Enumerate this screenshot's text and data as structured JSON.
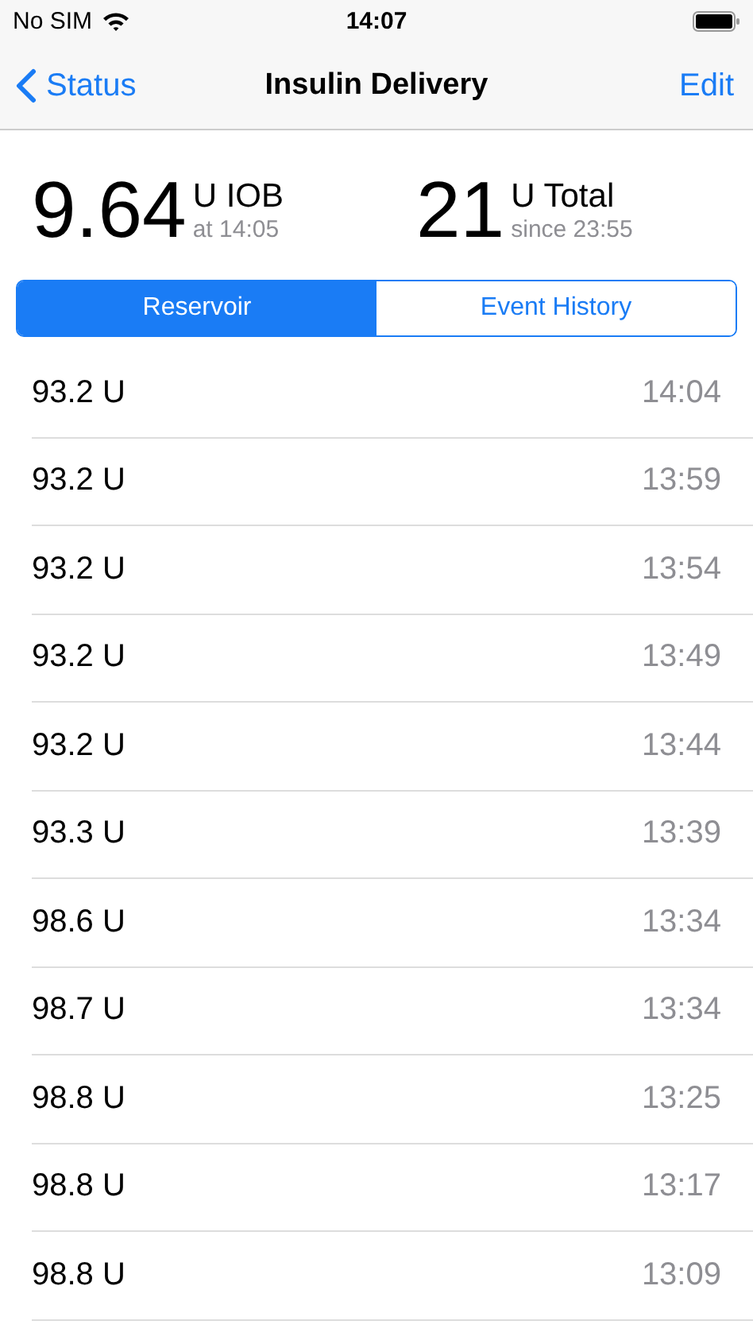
{
  "status_bar": {
    "carrier": "No SIM",
    "time": "14:07"
  },
  "nav": {
    "back": "Status",
    "title": "Insulin Delivery",
    "action": "Edit"
  },
  "stats": [
    {
      "value": "9.64",
      "unit": "U IOB",
      "detail": "at 14:05"
    },
    {
      "value": "21",
      "unit": "U Total",
      "detail": "since 23:55"
    }
  ],
  "tabs": [
    {
      "label": "Reservoir",
      "selected": true
    },
    {
      "label": "Event History",
      "selected": false
    }
  ],
  "rows": [
    {
      "amount": "93.2 U",
      "time": "14:04"
    },
    {
      "amount": "93.2 U",
      "time": "13:59"
    },
    {
      "amount": "93.2 U",
      "time": "13:54"
    },
    {
      "amount": "93.2 U",
      "time": "13:49"
    },
    {
      "amount": "93.2 U",
      "time": "13:44"
    },
    {
      "amount": "93.3 U",
      "time": "13:39"
    },
    {
      "amount": "98.6 U",
      "time": "13:34"
    },
    {
      "amount": "98.7 U",
      "time": "13:34"
    },
    {
      "amount": "98.8 U",
      "time": "13:25"
    },
    {
      "amount": "98.8 U",
      "time": "13:17"
    },
    {
      "amount": "98.8 U",
      "time": "13:09"
    }
  ]
}
